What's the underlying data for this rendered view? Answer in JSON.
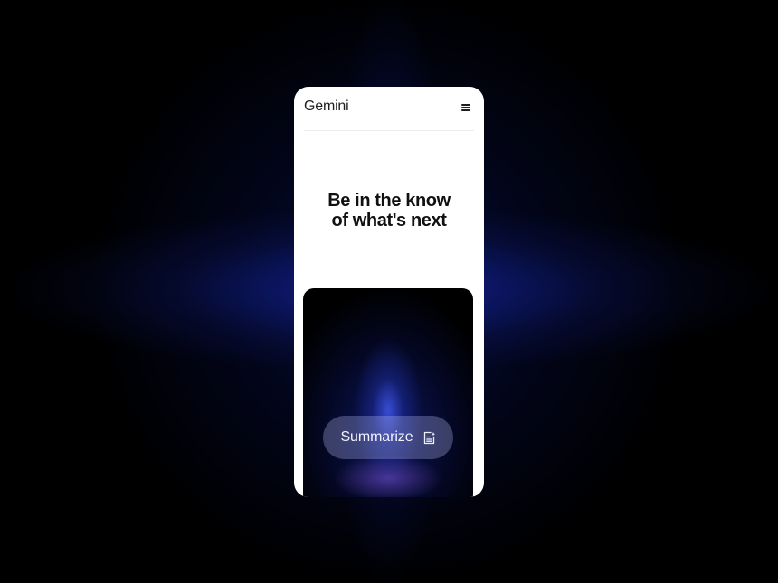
{
  "app": {
    "brand": "Gemini"
  },
  "hero": {
    "headline_line1": "Be in the know",
    "headline_line2": "of what's next"
  },
  "card": {
    "action_label": "Summarize",
    "action_icon": "document-sparkle-icon"
  },
  "colors": {
    "background": "#000000",
    "glow_accent": "#2a45e6",
    "phone_surface": "#ffffff",
    "headline_text": "#111111"
  }
}
